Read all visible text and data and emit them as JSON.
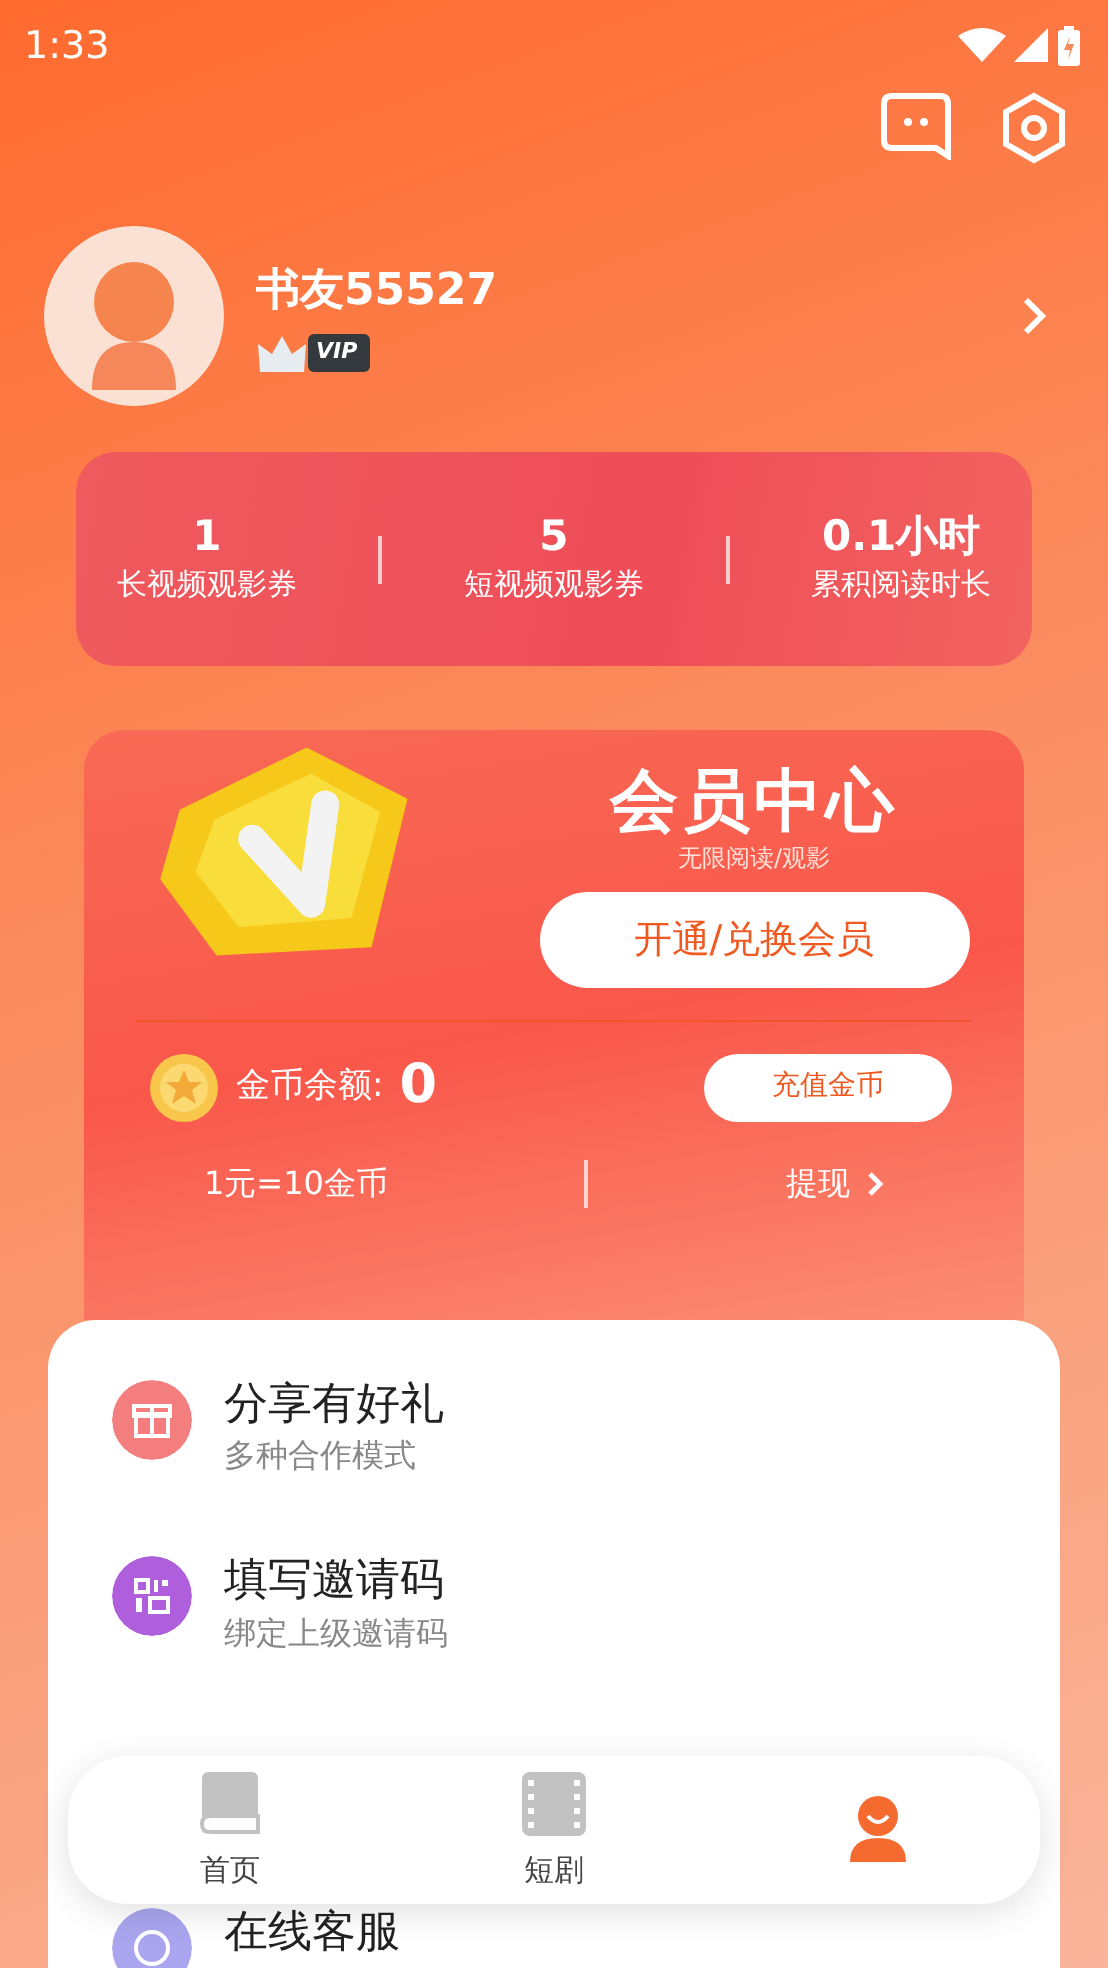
{
  "status_bar": {
    "time": "1:33"
  },
  "profile": {
    "name": "书友55527",
    "badge": "VIP"
  },
  "stats": [
    {
      "value": "1",
      "label": "长视频观影券"
    },
    {
      "value": "5",
      "label": "短视频观影券"
    },
    {
      "value": "0.1小时",
      "label": "累积阅读时长"
    }
  ],
  "member_card": {
    "title": "会员中心",
    "subtitle": "无限阅读/观影",
    "button": "开通/兑换会员",
    "coin_label": "金币余额:",
    "coin_value": "0",
    "recharge_button": "充值金币",
    "rate": "1元=10金币",
    "withdraw": "提现"
  },
  "menu": [
    {
      "kind": "gift",
      "title": "分享有好礼",
      "subtitle": "多种合作模式"
    },
    {
      "kind": "qr",
      "title": "填写邀请码",
      "subtitle": "绑定上级邀请码"
    },
    {
      "kind": "service",
      "title": "在线客服"
    }
  ],
  "tabs": [
    {
      "kind": "book",
      "label": "首页",
      "selected": false
    },
    {
      "kind": "film",
      "label": "短剧",
      "selected": false
    },
    {
      "kind": "person",
      "selected": true
    }
  ]
}
